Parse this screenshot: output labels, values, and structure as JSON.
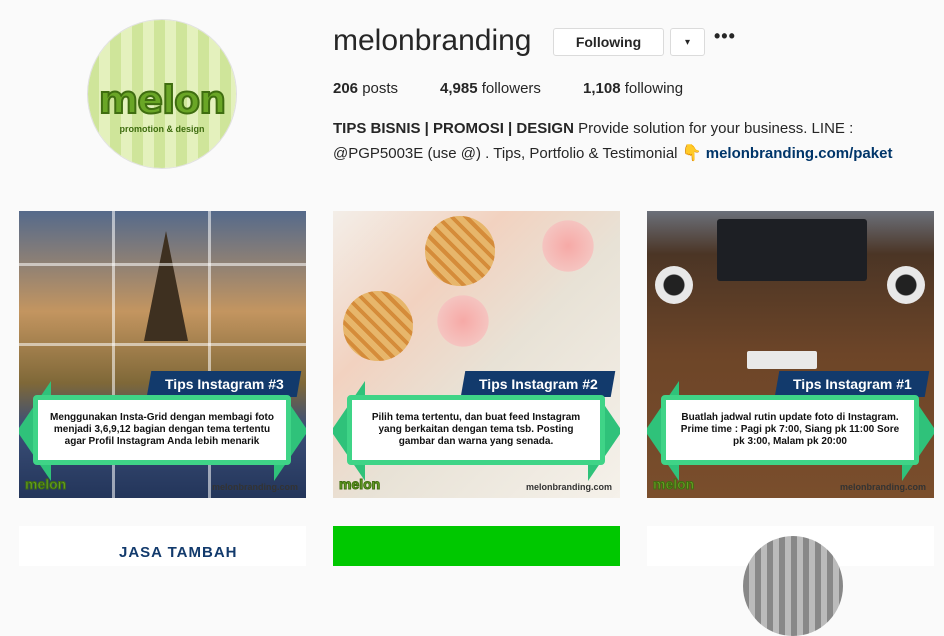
{
  "profile": {
    "avatar": {
      "logo_text": "melon",
      "logo_sub": "promotion & design",
      "colors": {
        "green": "#6aa626",
        "dark_green": "#3f6d10"
      }
    },
    "username": "melonbranding",
    "follow_button": "Following",
    "menu_icon": "▾",
    "more_icon": "•••",
    "stats": {
      "posts_count": "206",
      "posts_label": "posts",
      "followers_count": "4,985",
      "followers_label": "followers",
      "following_count": "1,108",
      "following_label": "following"
    },
    "bio": {
      "bold": "TIPS BISNIS | PROMOSI | DESIGN",
      "line1_rest": " Provide solution for your business. LINE :",
      "line2_text": "@PGP5003E (use @) . Tips, Portfolio & Testimonial ",
      "hand_icon": "👇",
      "link": "melonbranding.com/paket"
    }
  },
  "posts": [
    {
      "title": "Tips Instagram #3",
      "text": "Menggunakan Insta-Grid dengan membagi foto menjadi 3,6,9,12 bagian dengan tema tertentu agar Profil Instagram Anda lebih menarik",
      "logo": "melon",
      "url": "melonbranding.com"
    },
    {
      "title": "Tips Instagram #2",
      "text": "Pilih tema tertentu, dan buat feed Instagram yang berkaitan dengan tema tsb. Posting gambar dan warna yang senada.",
      "logo": "melon",
      "url": "melonbranding.com"
    },
    {
      "title": "Tips Instagram #1",
      "text": "Buatlah jadwal rutin update foto di Instagram. Prime time : Pagi pk 7:00, Siang pk 11:00 Sore pk 3:00, Malam pk 20:00",
      "logo": "melon",
      "url": "melonbranding.com"
    }
  ],
  "bottom_posts": {
    "first_title": "JASA TAMBAH"
  },
  "colors": {
    "title_bg": "#123a6c",
    "panel_border": "#3fd487",
    "link": "#003569"
  }
}
